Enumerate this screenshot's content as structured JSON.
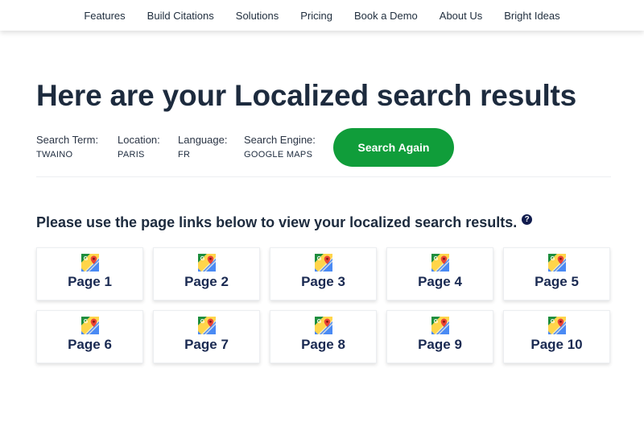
{
  "nav": {
    "items": [
      "Features",
      "Build Citations",
      "Solutions",
      "Pricing",
      "Book a Demo",
      "About Us",
      "Bright Ideas"
    ]
  },
  "header": {
    "title": "Here are your Localized search results"
  },
  "search": {
    "term_label": "Search Term:",
    "term_value": "TWAINO",
    "location_label": "Location:",
    "location_value": "PARIS",
    "language_label": "Language:",
    "language_value": "FR",
    "engine_label": "Search Engine:",
    "engine_value": "GOOGLE MAPS",
    "search_again_label": "Search Again"
  },
  "results": {
    "instructions": "Please use the page links below to view your localized search results.",
    "help_icon": "?",
    "pages": [
      "Page 1",
      "Page 2",
      "Page 3",
      "Page 4",
      "Page 5",
      "Page 6",
      "Page 7",
      "Page 8",
      "Page 9",
      "Page 10"
    ],
    "card_icon": "google-maps-icon"
  },
  "colors": {
    "accent_green": "#109d3a",
    "title_navy": "#1d2b3e",
    "page_label_navy": "#1a2a52"
  }
}
